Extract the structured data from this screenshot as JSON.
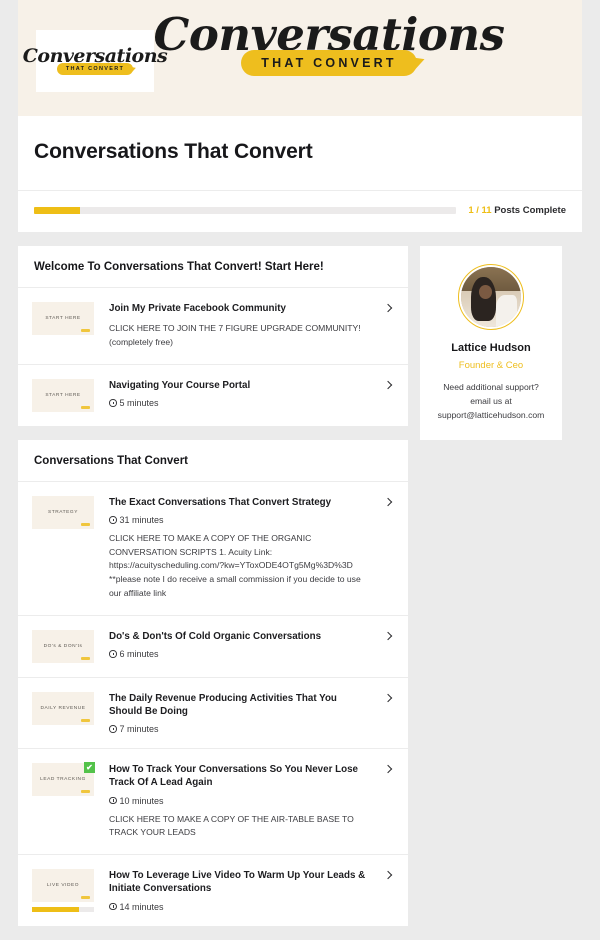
{
  "hero": {
    "logo_card": {
      "script_text": "Conversations",
      "badge_text": "THAT CONVERT"
    },
    "main_logo": {
      "script_text": "Conversations",
      "badge_text": "THAT CONVERT"
    }
  },
  "header": {
    "page_title": "Conversations That Convert"
  },
  "progress": {
    "count_text": "1 / 11",
    "label_text": "Posts Complete",
    "percent": 11,
    "fill_color": "#eebe16",
    "track_color": "#eceaea"
  },
  "sections": [
    {
      "heading": "Welcome To Conversations That Convert! Start Here!",
      "lessons": [
        {
          "thumb_label": "START HERE",
          "title": "Join My Private Facebook Community",
          "duration": "",
          "description": "CLICK HERE TO JOIN THE 7 FIGURE UPGRADE COMMUNITY! (completely free)",
          "completed": false,
          "watch_percent": 0
        },
        {
          "thumb_label": "START HERE",
          "title": "Navigating Your Course Portal",
          "duration": "5 minutes",
          "description": "",
          "completed": false,
          "watch_percent": 0
        }
      ]
    },
    {
      "heading": "Conversations That Convert",
      "lessons": [
        {
          "thumb_label": "STRATEGY",
          "title": "The Exact Conversations That Convert Strategy",
          "duration": "31 minutes",
          "description": "CLICK HERE TO MAKE A COPY OF THE ORGANIC CONVERSATION SCRIPTS   1. Acuity Link:  https://acuityscheduling.com/?kw=YToxODE4OTg5Mg%3D%3D   **please note I do receive a small commission if you decide to use our affiliate link",
          "completed": false,
          "watch_percent": 0
        },
        {
          "thumb_label": "DO's & DON'ts",
          "title": "Do's & Don'ts Of Cold Organic Conversations",
          "duration": "6 minutes",
          "description": "",
          "completed": false,
          "watch_percent": 0
        },
        {
          "thumb_label": "DAILY REVENUE",
          "title": "The Daily Revenue Producing Activities That You Should Be Doing",
          "duration": "7 minutes",
          "description": "",
          "completed": false,
          "watch_percent": 0
        },
        {
          "thumb_label": "LEAD TRACKING",
          "title": "How To Track Your Conversations So You Never Lose Track Of A Lead Again",
          "duration": "10 minutes",
          "description": "CLICK HERE TO MAKE A COPY OF THE AIR-TABLE BASE TO TRACK YOUR LEADS",
          "completed": true,
          "watch_percent": 0
        },
        {
          "thumb_label": "LIVE VIDEO",
          "title": "How To Leverage Live Video To Warm Up Your Leads & Initiate Conversations",
          "duration": "14 minutes",
          "description": "",
          "completed": false,
          "watch_percent": 75
        }
      ]
    }
  ],
  "profile": {
    "name": "Lattice Hudson",
    "role": "Founder & Ceo",
    "support_text": "Need additional support? email us at support@latticehudson.com",
    "accent_color": "#eebe1e"
  },
  "icons": {
    "chevron": "chevron-right-icon",
    "clock": "clock-icon",
    "check": "✔"
  }
}
